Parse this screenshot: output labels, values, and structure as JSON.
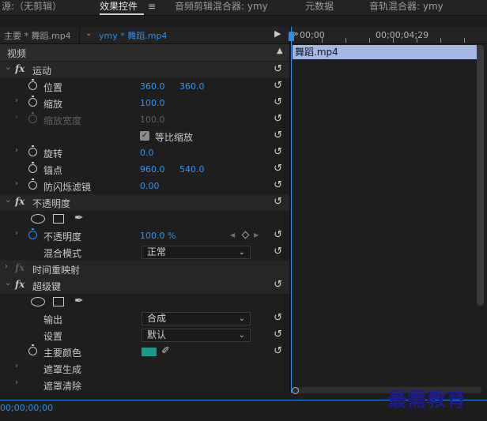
{
  "tabs": [
    {
      "label": "源:（无剪辑）",
      "active": false
    },
    {
      "label": "效果控件",
      "active": true
    },
    {
      "label": "音频剪辑混合器: ymy",
      "active": false
    },
    {
      "label": "元数据",
      "active": false
    },
    {
      "label": "音轨混合器: ymy",
      "active": false
    }
  ],
  "tab_menu_icon": "≡",
  "clip_selector": {
    "master": "主要 * 舞蹈.mp4",
    "sequence": "ymy * 舞蹈.mp4"
  },
  "timeline": {
    "timecode_start": "00;00",
    "timecode_mid": "00;00;04;29",
    "clip_label": "舞蹈.mp4",
    "playhead_color": "#2d8ceb",
    "clip_color": "#a5b7e3"
  },
  "bottom": {
    "current_timecode": "00;00;00;00"
  },
  "video_header": "视频",
  "motion": {
    "title": "运动",
    "position_label": "位置",
    "position_x": "360.0",
    "position_y": "360.0",
    "scale_label": "缩放",
    "scale_value": "100.0",
    "scale_width_label": "缩放宽度",
    "scale_width_value": "100.0",
    "uniform_scale_label": "等比缩放",
    "uniform_scale_checked": true,
    "rotation_label": "旋转",
    "rotation_value": "0.0",
    "anchor_label": "锚点",
    "anchor_x": "960.0",
    "anchor_y": "540.0",
    "antiflicker_label": "防闪烁滤镜",
    "antiflicker_value": "0.00"
  },
  "opacity": {
    "title": "不透明度",
    "opacity_label": "不透明度",
    "opacity_value": "100.0 %",
    "blend_label": "混合模式",
    "blend_value": "正常"
  },
  "time_remap": {
    "title": "时间重映射"
  },
  "ultra_key": {
    "title": "超级键",
    "output_label": "输出",
    "output_value": "合成",
    "settings_label": "设置",
    "settings_value": "默认",
    "key_color_label": "主要颜色",
    "key_color": "#1a9a88",
    "matte_gen_label": "遮罩生成",
    "matte_cleanup_label": "遮罩清除"
  },
  "watermark": "最需教育",
  "icons": {
    "fx": "fx",
    "reset": "reset-icon",
    "stopwatch": "stopwatch-icon",
    "pen": "pen-icon",
    "eyedropper": "eyedropper-icon"
  }
}
